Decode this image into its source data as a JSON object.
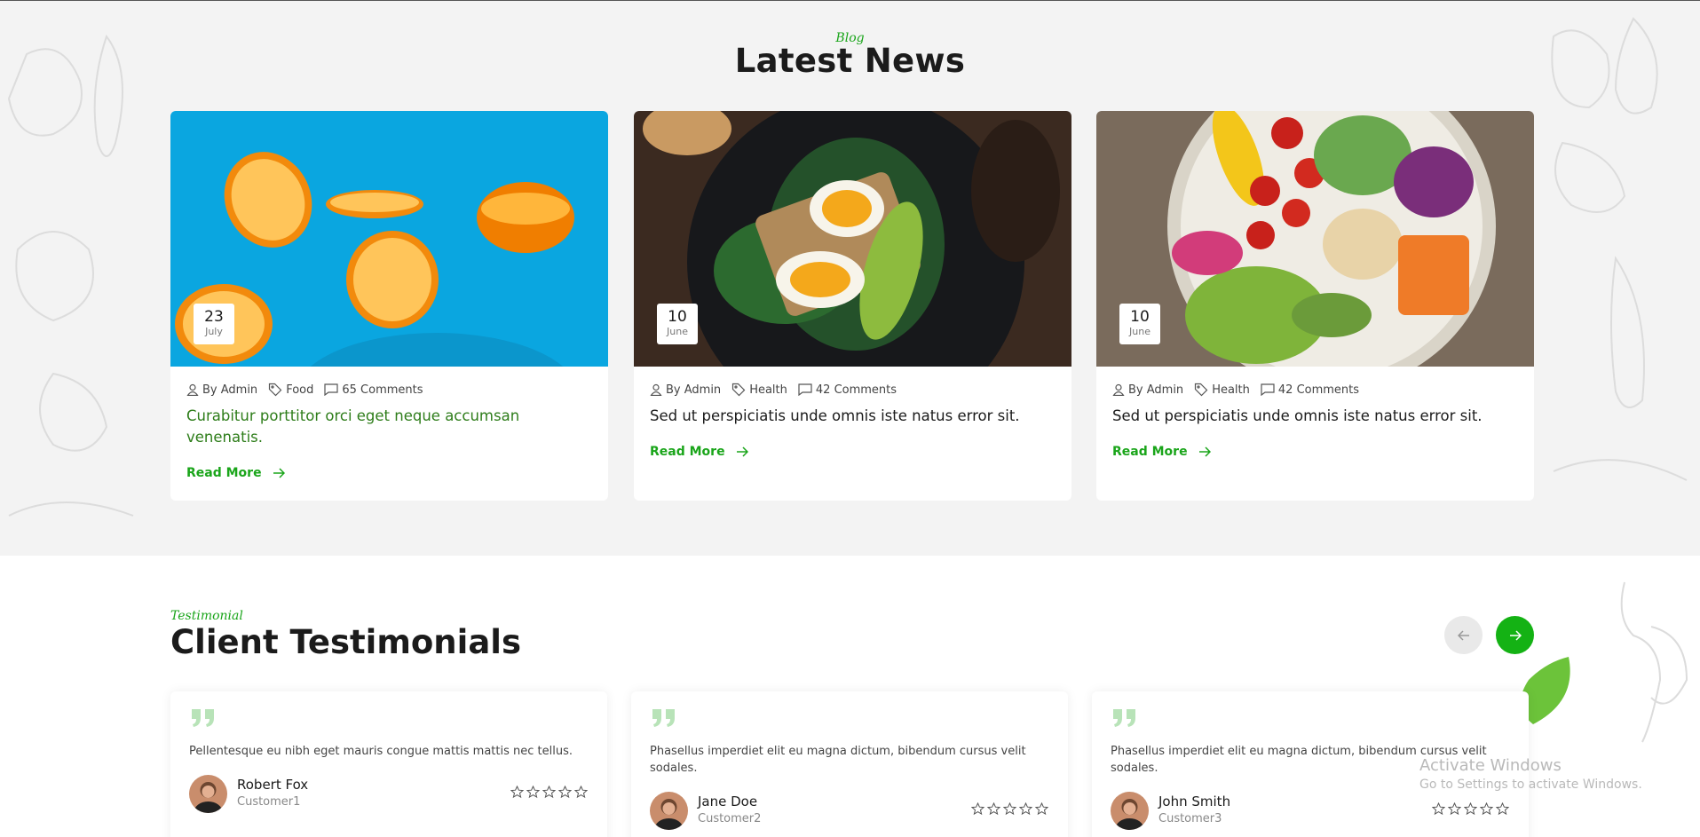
{
  "blog": {
    "eyebrow": "Blog",
    "title": "Latest News",
    "posts": [
      {
        "day": "23",
        "month": "July",
        "author": "By Admin",
        "category": "Food",
        "comments": "65 Comments",
        "title": "Curabitur porttitor orci eget neque accumsan venenatis.",
        "read_more": "Read More",
        "image": "orange-slices-photo"
      },
      {
        "day": "10",
        "month": "June",
        "author": "By Admin",
        "category": "Health",
        "comments": "42 Comments",
        "title": "Sed ut perspiciatis unde omnis iste natus error sit.",
        "read_more": "Read More",
        "image": "egg-avocado-toast-photo"
      },
      {
        "day": "10",
        "month": "June",
        "author": "By Admin",
        "category": "Health",
        "comments": "42 Comments",
        "title": "Sed ut perspiciatis unde omnis iste natus error sit.",
        "read_more": "Read More",
        "image": "salad-bowl-photo"
      }
    ]
  },
  "testimonials": {
    "eyebrow": "Testimonial",
    "title": "Client Testimonials",
    "items": [
      {
        "quote": "Pellentesque eu nibh eget mauris congue mattis mattis nec tellus.",
        "name": "Robert Fox",
        "role": "Customer1",
        "rating": 0
      },
      {
        "quote": "Phasellus imperdiet elit eu magna dictum, bibendum cursus velit sodales.",
        "name": "Jane Doe",
        "role": "Customer2",
        "rating": 0
      },
      {
        "quote": "Phasellus imperdiet elit eu magna dictum, bibendum cursus velit sodales.",
        "name": "John Smith",
        "role": "Customer3",
        "rating": 0
      }
    ]
  },
  "watermark": {
    "line1": "Activate Windows",
    "line2": "Go to Settings to activate Windows."
  },
  "colors": {
    "accent": "#14b214",
    "background": "#f3f3f3",
    "title_highlight": "#2e7d1a"
  }
}
